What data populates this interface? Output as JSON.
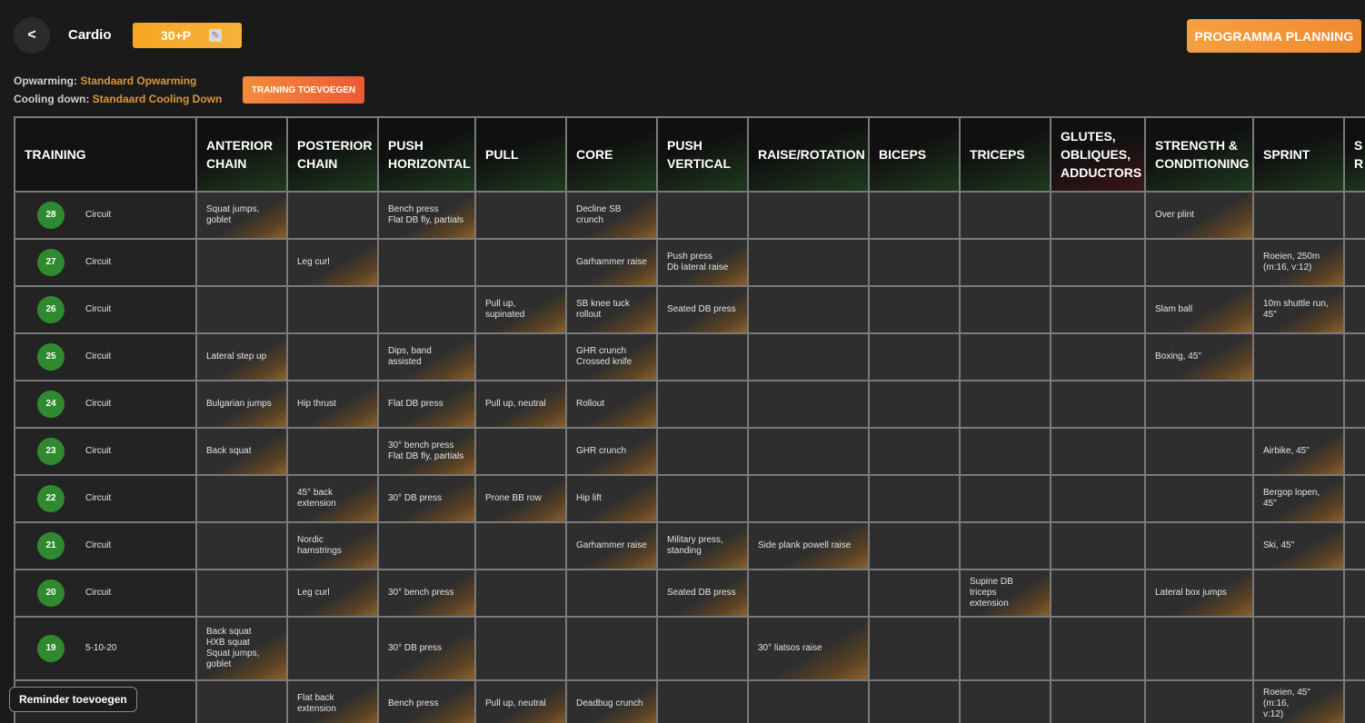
{
  "header": {
    "back_label": "<",
    "title": "Cardio",
    "badge_label": "30+P",
    "planning_button": "PROGRAMMA PLANNING"
  },
  "meta": {
    "warmup_label": "Opwarming:",
    "warmup_value": "Standaard Opwarming",
    "cooldown_label": "Cooling down:",
    "cooldown_value": "Standaard Cooling Down",
    "add_training_button": "TRAINING TOEVOEGEN"
  },
  "reminder_button": "Reminder toevoegen",
  "colors": {
    "accent": "#f5a623",
    "accent_dark": "#ec5a35",
    "badge_green": "#2f8a2f",
    "link_orange": "#d8963a"
  },
  "table": {
    "columns": [
      {
        "label": "TRAINING"
      },
      {
        "label": "ANTERIOR CHAIN"
      },
      {
        "label": "POSTERIOR CHAIN"
      },
      {
        "label": "PUSH HORIZONTAL"
      },
      {
        "label": "PULL"
      },
      {
        "label": "CORE"
      },
      {
        "label": "PUSH VERTICAL"
      },
      {
        "label": "RAISE/ROTATION"
      },
      {
        "label": "BICEPS"
      },
      {
        "label": "TRICEPS"
      },
      {
        "label": "GLUTES, OBLIQUES, ADDUCTORS"
      },
      {
        "label": "STRENGTH & CONDITIONING"
      },
      {
        "label": "SPRINT"
      },
      {
        "label": "S R I"
      }
    ],
    "rows": [
      {
        "num": "28",
        "type": "Circuit",
        "cells": [
          [
            "Squat jumps,",
            "goblet"
          ],
          [],
          [
            "Bench press",
            "Flat DB fly, partials"
          ],
          [],
          [
            "Decline SB",
            "crunch"
          ],
          [],
          [],
          [],
          [],
          [],
          [
            "Over plint"
          ],
          [],
          []
        ]
      },
      {
        "num": "27",
        "type": "Circuit",
        "cells": [
          [],
          [
            "Leg curl"
          ],
          [],
          [],
          [
            "Garhammer raise"
          ],
          [
            "Push press",
            "Db lateral raise"
          ],
          [],
          [],
          [],
          [],
          [],
          [
            "Roeien, 250m",
            "(m:16, v:12)"
          ],
          []
        ]
      },
      {
        "num": "26",
        "type": "Circuit",
        "cells": [
          [],
          [],
          [],
          [
            "Pull up, supinated"
          ],
          [
            "SB knee tuck",
            "rollout"
          ],
          [
            "Seated DB press"
          ],
          [],
          [],
          [],
          [],
          [
            "Slam ball"
          ],
          [
            "10m shuttle run,",
            "45\""
          ],
          []
        ]
      },
      {
        "num": "25",
        "type": "Circuit",
        "cells": [
          [
            "Lateral step up"
          ],
          [],
          [
            "Dips, band assisted"
          ],
          [],
          [
            "GHR crunch",
            "Crossed knife"
          ],
          [],
          [],
          [],
          [],
          [],
          [
            "Boxing, 45\""
          ],
          [],
          []
        ]
      },
      {
        "num": "24",
        "type": "Circuit",
        "cells": [
          [
            "Bulgarian jumps"
          ],
          [
            "Hip thrust"
          ],
          [
            "Flat DB press"
          ],
          [
            "Pull up, neutral"
          ],
          [
            "Rollout"
          ],
          [],
          [],
          [],
          [],
          [],
          [],
          [],
          []
        ]
      },
      {
        "num": "23",
        "type": "Circuit",
        "cells": [
          [
            "Back squat"
          ],
          [],
          [
            "30° bench press",
            "Flat DB fly, partials"
          ],
          [],
          [
            "GHR crunch"
          ],
          [],
          [],
          [],
          [],
          [],
          [],
          [
            "Airbike, 45\""
          ],
          []
        ]
      },
      {
        "num": "22",
        "type": "Circuit",
        "cells": [
          [],
          [
            "45° back",
            "extension"
          ],
          [
            "30° DB press"
          ],
          [
            "Prone BB row"
          ],
          [
            "Hip lift"
          ],
          [],
          [],
          [],
          [],
          [],
          [],
          [
            "Bergop lopen, 45\""
          ],
          []
        ]
      },
      {
        "num": "21",
        "type": "Circuit",
        "cells": [
          [],
          [
            "Nordic",
            "hamstrings"
          ],
          [],
          [],
          [
            "Garhammer raise"
          ],
          [
            "Military press,",
            "standing"
          ],
          [
            "Side plank powell raise"
          ],
          [],
          [],
          [],
          [],
          [
            "Ski, 45\""
          ],
          []
        ]
      },
      {
        "num": "20",
        "type": "Circuit",
        "cells": [
          [],
          [
            "Leg curl"
          ],
          [
            "30° bench press"
          ],
          [],
          [],
          [
            "Seated DB press"
          ],
          [],
          [],
          [
            "Supine DB triceps",
            "extension"
          ],
          [],
          [
            "Lateral box jumps"
          ],
          [],
          []
        ]
      },
      {
        "num": "19",
        "type": "5-10-20",
        "cells": [
          [
            "Back squat",
            "HXB squat",
            "Squat jumps,",
            "goblet"
          ],
          [],
          [
            "30° DB press"
          ],
          [],
          [],
          [],
          [
            "30° liatsos raise"
          ],
          [],
          [],
          [],
          [],
          [],
          []
        ]
      },
      {
        "num": "",
        "type": "",
        "cells": [
          [],
          [
            "Flat back",
            "extension"
          ],
          [
            "Bench press"
          ],
          [
            "Pull up, neutral"
          ],
          [
            "Deadbug crunch"
          ],
          [],
          [],
          [],
          [],
          [],
          [],
          [
            "Roeien, 45\" (m:16,",
            "v:12)"
          ],
          []
        ]
      }
    ]
  }
}
